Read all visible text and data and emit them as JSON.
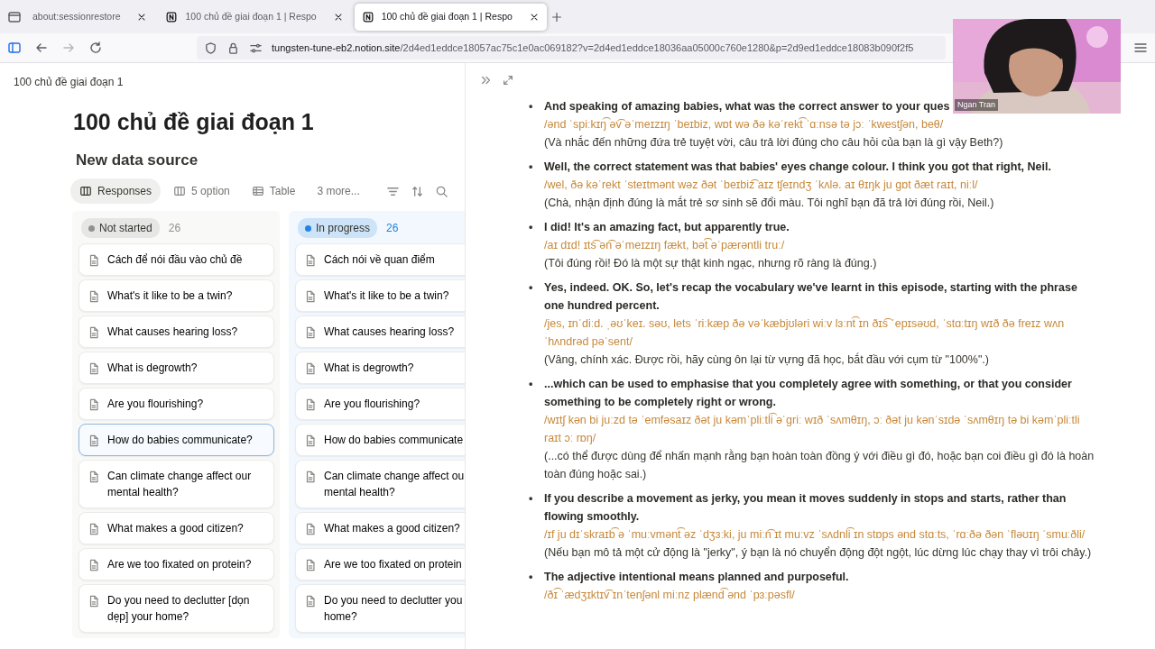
{
  "browser": {
    "tabs": [
      {
        "title": "about:sessionrestore",
        "kind": "plain",
        "selected": false
      },
      {
        "title": "100 chủ đề giai đoạn 1 | Respo",
        "kind": "page",
        "selected": false
      },
      {
        "title": "100 chủ đề giai đoạn 1 | Respo",
        "kind": "page",
        "selected": true
      }
    ],
    "url": {
      "host": "tungsten-tune-eb2.notion.site",
      "path": "/2d4ed1eddce18057ac75c1e0ac069182?v=2d4ed1eddce18036aa05000c760e1280&p=2d9ed1eddce18083b090f2f5"
    }
  },
  "page": {
    "breadcrumb": "100 chủ đề giai đoạn 1",
    "title": "100 chủ đề giai đoạn 1",
    "subtitle": "New data source",
    "views": [
      {
        "label": "Responses",
        "kind": "board",
        "selected": true
      },
      {
        "label": "5 option",
        "kind": "board",
        "selected": false
      },
      {
        "label": "Table",
        "kind": "table",
        "selected": false
      }
    ],
    "more_views": "3 more...",
    "groups": [
      {
        "status": "Not started",
        "color": "#91918e",
        "count": "26",
        "cards": [
          {
            "title": "Cách để nói đầu vào chủ đề",
            "selected": false
          },
          {
            "title": "What's it like to be a twin?",
            "selected": false
          },
          {
            "title": "What causes hearing loss?",
            "selected": false
          },
          {
            "title": "What is degrowth?",
            "selected": false
          },
          {
            "title": "Are you flourishing?",
            "selected": false
          },
          {
            "title": "How do babies communicate?",
            "selected": true
          },
          {
            "title": "Can climate change affect our mental health?",
            "selected": false
          },
          {
            "title": "What makes a good citizen?",
            "selected": false
          },
          {
            "title": "Are we too fixated on protein?",
            "selected": false
          },
          {
            "title": "Do you need to declutter [dọn dẹp] your home?",
            "selected": false
          }
        ]
      },
      {
        "status": "In progress",
        "color": "#2383e2",
        "count": "26",
        "cards": [
          {
            "title": "Cách nói về quan điểm",
            "selected": false
          },
          {
            "title": "What's it like to be a twin?",
            "selected": false
          },
          {
            "title": "What causes hearing loss?",
            "selected": false
          },
          {
            "title": "What is degrowth?",
            "selected": false
          },
          {
            "title": "Are you flourishing?",
            "selected": false
          },
          {
            "title": "How do babies communicate",
            "selected": false
          },
          {
            "title": "Can climate change affect ou mental health?",
            "selected": false
          },
          {
            "title": "What makes a good citizen?",
            "selected": false
          },
          {
            "title": "Are we too fixated on protein",
            "selected": false
          },
          {
            "title": "Do you need to declutter you home?",
            "selected": false
          }
        ]
      }
    ]
  },
  "peek": {
    "entries": [
      {
        "bullet": "•",
        "english": "And speaking of amazing babies, what was the correct answer to your ques",
        "ipa": "/ənd ˈspiːkɪŋ͡ əv͡ əˈmeɪzɪŋ ˈbeɪbiz, wɒt wə ðə kəˈrekt͡ ˈɑːnsə tə jɔː ˈkwestʃən, beθ/",
        "vietnamese": "(Và nhắc đến những đứa trẻ tuyệt vời, câu trả lời đúng cho câu hỏi của bạn là gì vậy Beth?)"
      },
      {
        "bullet": "•",
        "english": "Well, the correct statement was that babies' eyes change colour. I think you got that right, Neil.",
        "ipa": "/wel, ðə kəˈrekt ˈsteɪtmənt wəz ðət ˈbeɪbiz͡ aɪz tʃeɪndʒ ˈkʌlə. aɪ θɪŋk ju gɒt ðæt raɪt, niːl/",
        "vietnamese": "(Chà, nhận định đúng là mắt trẻ sơ sinh sẽ đổi màu. Tôi nghĩ bạn đã trả lời đúng rồi, Neil.)"
      },
      {
        "bullet": "•",
        "english": "I did! It's an amazing fact, but apparently true.",
        "ipa": "/aɪ dɪd! ɪts͡ ən͡ əˈmeɪzɪŋ fækt, bət͡ əˈpærəntli truː/",
        "vietnamese": "(Tôi đúng rồi! Đó là một sự thật kinh ngạc, nhưng rõ ràng là đúng.)"
      },
      {
        "bullet": "•",
        "english": "Yes, indeed. OK. So, let's recap the vocabulary we've learnt in this episode, starting with the phrase one hundred percent.",
        "ipa": "/jes, ɪnˈdiːd. ˌəʊˈkeɪ. səʊ, lets ˈriːkæp ðə vəˈkæbjʊləri wiːv lɜːnt͡ ɪn ðɪs͡ ˈepɪsəʊd, ˈstɑːtɪŋ wɪð ðə freɪz wʌn ˈhʌndrəd pəˈsent/",
        "vietnamese": "(Vâng, chính xác. Được rồi, hãy cùng ôn lại từ vựng đã học, bắt đầu với cụm từ \"100%\".)"
      },
      {
        "bullet": "•",
        "english": "...which can be used to emphasise that you completely agree with something, or that you consider something to be completely right or wrong.",
        "ipa": "/wɪtʃ kən bi juːzd tə ˈemfəsaɪz ðət ju kəmˈpliːtli͡ əˈgriː wɪð ˈsʌmθɪŋ, ɔː ðət ju kənˈsɪdə ˈsʌmθɪŋ tə bi kəmˈpliːtli raɪt ɔː rɒŋ/",
        "vietnamese": "(...có thể được dùng để nhấn mạnh rằng bạn hoàn toàn đồng ý với điều gì đó, hoặc bạn coi điều gì đó là hoàn toàn đúng hoặc sai.)"
      },
      {
        "bullet": "•",
        "english": "If you describe a movement as jerky, you mean it moves suddenly in stops and starts, rather than flowing smoothly.",
        "ipa": "/ɪf ju dɪˈskraɪb͡ ə ˈmuːvmənt͡ əz ˈdʒɜːki, ju miːn͡ ɪt muːvz ˈsʌdnli͡ ɪn stɒps ənd stɑːts, ˈrɑːðə ðən ˈfləʊɪŋ ˈsmuːðli/",
        "vietnamese": "(Nếu bạn mô tả một cử động là \"jerky\", ý bạn là nó chuyển động đột ngột, lúc dừng lúc chạy thay vì trôi chảy.)"
      },
      {
        "bullet": "•",
        "english": "The adjective intentional means planned and purposeful.",
        "ipa": "/ðɪ͡ ˈædʒɪktɪv͡ ɪnˈtenʃənl miːnz plænd͡ ənd ˈpɜːpəsfl/"
      }
    ]
  },
  "video_call": {
    "participant": "Ngan Tran"
  }
}
